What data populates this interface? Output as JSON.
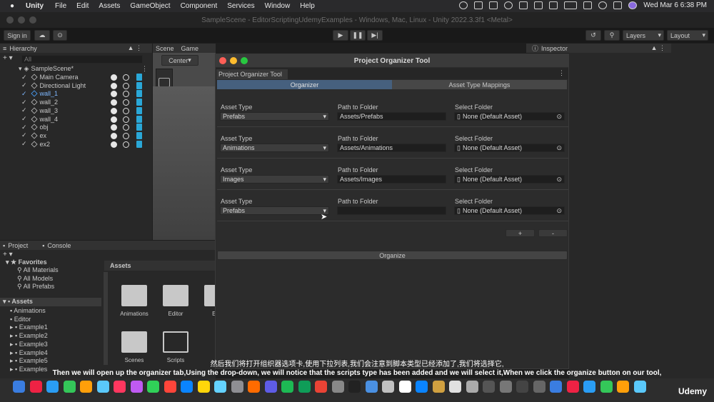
{
  "menubar": {
    "apple": "",
    "app": "Unity",
    "items": [
      "File",
      "Edit",
      "Assets",
      "GameObject",
      "Component",
      "Services",
      "Window",
      "Help"
    ],
    "clock": "Wed Mar 6  6:38 PM"
  },
  "window_title": "SampleScene - EditorScriptingUdemyExamples - Windows, Mac, Linux - Unity 2022.3.3f1 <Metal>",
  "toolbar": {
    "signin": "Sign in",
    "layers": "Layers",
    "layout": "Layout"
  },
  "hierarchy": {
    "tab": "Hierarchy",
    "search": "All",
    "scene": "SampleScene*",
    "items": [
      "Main Camera",
      "Directional Light",
      "wall_1",
      "wall_2",
      "wall_3",
      "wall_4",
      "obj",
      "ex",
      "ex2"
    ]
  },
  "scene_tabs": [
    "Scene",
    "Game"
  ],
  "scene_tool": "Center",
  "inspector_tab": "Inspector",
  "project": {
    "tabs": [
      "Project",
      "Console"
    ],
    "favorites": "Favorites",
    "fav_items": [
      "All Materials",
      "All Models",
      "All Prefabs"
    ],
    "assets": "Assets",
    "tree": [
      "Animations",
      "Editor",
      "Example1",
      "Example2",
      "Example3",
      "Example4",
      "Example5",
      "Examples"
    ],
    "crumb": "Assets",
    "folders": [
      "Animations",
      "Editor",
      "Exa",
      "Scenes",
      "Scripts"
    ]
  },
  "tool": {
    "title": "Project Organizer Tool",
    "tab": "Project Organizer Tool",
    "subtabs": [
      "Organizer",
      "Asset Type Mappings"
    ],
    "labels": {
      "type": "Asset Type",
      "path": "Path to Folder",
      "folder": "Select Folder"
    },
    "rows": [
      {
        "type": "Prefabs",
        "path": "Assets/Prefabs",
        "folder": "None (Default Asset)"
      },
      {
        "type": "Animations",
        "path": "Assets/Animations",
        "folder": "None (Default Asset)"
      },
      {
        "type": "Images",
        "path": "Assets/Images",
        "folder": "None (Default Asset)"
      },
      {
        "type": "Prefabs",
        "path": "",
        "folder": "None (Default Asset)"
      }
    ],
    "plus": "+",
    "minus": "-",
    "organize": "Organize"
  },
  "subtitles": {
    "zh": "然后我们将打开组织器选项卡,使用下拉列表,我们会注意到脚本类型已经添加了,我们将选择它,",
    "en": "Then we will open up the organizer tab,Using the drop-down, we will notice that the scripts type has been added and we will select it,When we click the organize button on our tool,"
  },
  "watermark": "Udemy"
}
